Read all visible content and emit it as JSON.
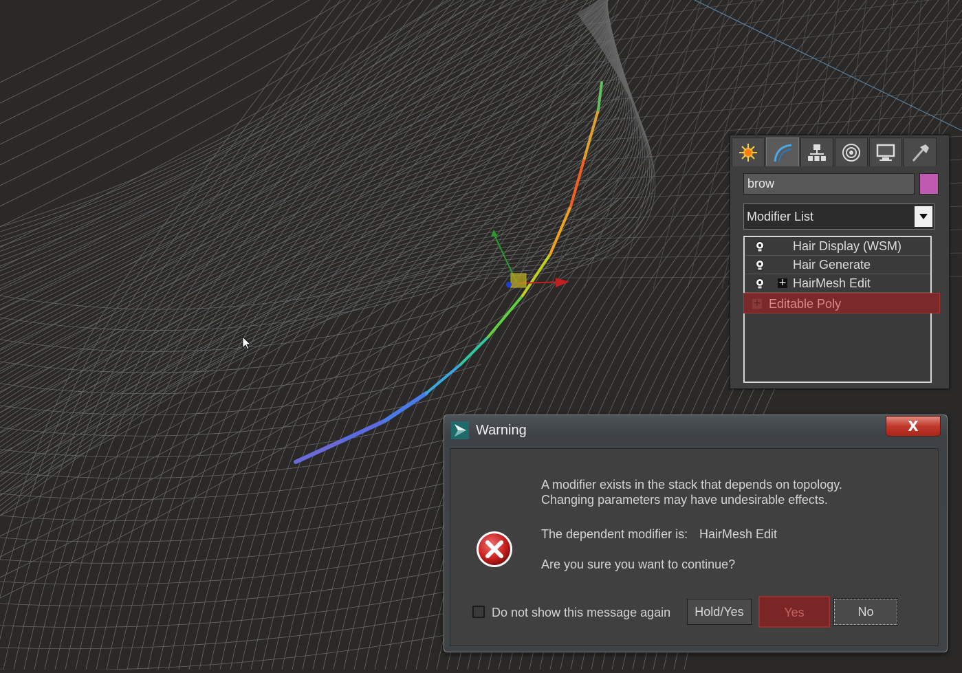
{
  "command_panel": {
    "tabs": [
      {
        "icon": "create-icon"
      },
      {
        "icon": "modify-icon"
      },
      {
        "icon": "hierarchy-icon"
      },
      {
        "icon": "motion-icon"
      },
      {
        "icon": "display-icon"
      },
      {
        "icon": "utilities-icon"
      }
    ],
    "active_tab": 1,
    "object_name": "brow",
    "object_color": "#c05ab0",
    "modifier_list_label": "Modifier List",
    "stack": [
      {
        "label": "Hair Display (WSM)",
        "has_bulb": true,
        "expandable": false
      },
      {
        "label": "Hair Generate",
        "has_bulb": true,
        "expandable": false
      },
      {
        "label": "HairMesh Edit",
        "has_bulb": true,
        "expandable": true
      },
      {
        "label": "Editable Poly",
        "has_bulb": false,
        "expandable": true,
        "selected": true
      }
    ]
  },
  "dialog": {
    "title": "Warning",
    "close_label": "X",
    "message_line1": "A modifier exists in the stack that depends on topology.",
    "message_line2": "Changing parameters may have undesirable effects.",
    "dependent_label": "The dependent modifier is:",
    "dependent_value": "HairMesh Edit",
    "confirm_question": "Are you sure you want to continue?",
    "checkbox_label": "Do not show this message again",
    "checkbox_checked": false,
    "buttons": {
      "hold_yes": "Hold/Yes",
      "yes": "Yes",
      "no": "No"
    }
  },
  "colors": {
    "viewport_bg": "#2a2928",
    "wireframe": "#9a9a9a",
    "selection_red": "#7a2a2a"
  }
}
